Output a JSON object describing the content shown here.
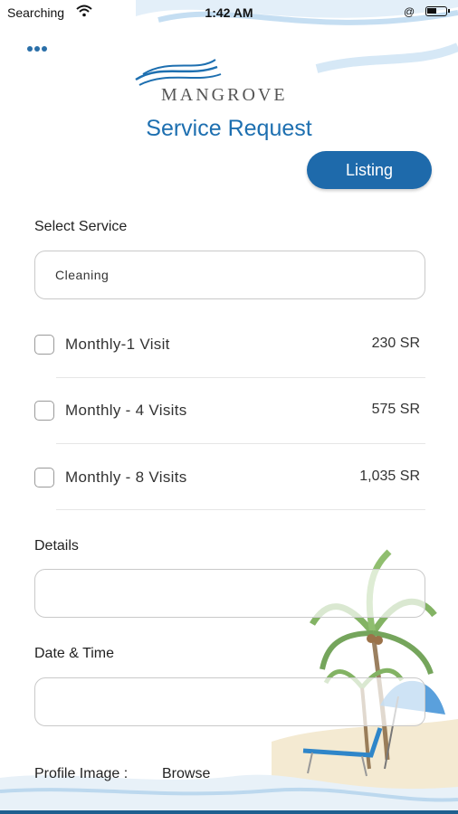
{
  "status_bar": {
    "carrier": "Searching",
    "time": "1:42 AM",
    "location_glyph": "@"
  },
  "brand": {
    "logo_text": "MANGROVE"
  },
  "page_title": "Service Request",
  "listing_button": "Listing",
  "select_service": {
    "label": "Select Service",
    "value": "Cleaning"
  },
  "options": [
    {
      "label": "Monthly-1 Visit",
      "price": "230 SR",
      "checked": false
    },
    {
      "label": "Monthly - 4 Visits",
      "price": "575 SR",
      "checked": false
    },
    {
      "label": "Monthly - 8 Visits",
      "price": "1,035 SR",
      "checked": false
    }
  ],
  "details": {
    "label": "Details",
    "value": ""
  },
  "date_time": {
    "label": "Date & Time",
    "value": ""
  },
  "profile_image": {
    "label": "Profile Image :",
    "browse": "Browse"
  },
  "colors": {
    "accent": "#1e6aab",
    "title": "#1d6fb0",
    "wave": "#bcd8ee"
  }
}
